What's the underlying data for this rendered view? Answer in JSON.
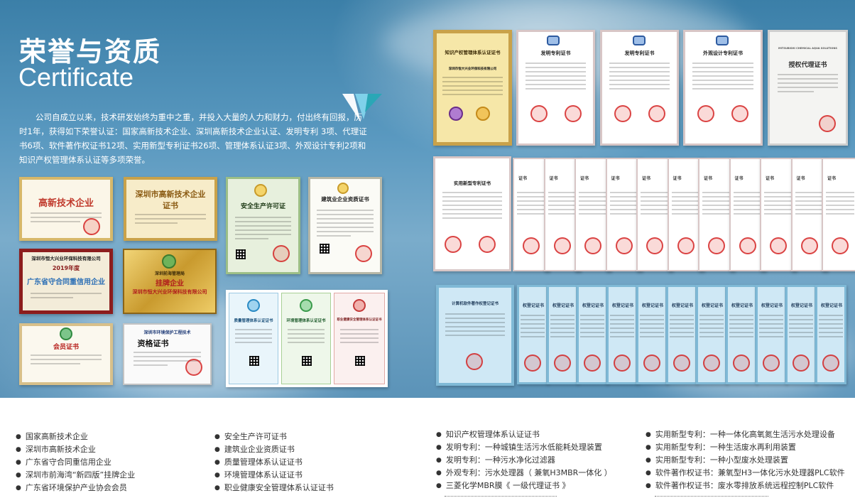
{
  "header": {
    "title_cn": "荣誉与资质",
    "title_en": "Certificate",
    "intro": "公司自成立以来，技术研发始终为重中之重，并投入大量的人力和财力，付出终有回报，历时1年，获得如下荣誉认证：国家高新技术企业、深圳高新技术企业认证、发明专利 3项、代理证书6项、软件著作权证书12项、实用新型专利证书26项、管理体系认证3项、外观设计专利2项和知识产权管理体系认证等多项荣誉。"
  },
  "certificates": {
    "left": {
      "gaoxin": "高新技术企业",
      "shenzhen_gaoxin": "深圳市高新技术企业",
      "shenzhen_gaoxin_sub": "证书",
      "anquan": "安全生产许可证",
      "jianzhu": "建筑业企业资质证书",
      "shouxin_top": "深圳市恒大兴业环保科技有限公司",
      "shouxin_year": "2019年度",
      "shouxin_main": "广东省守合同重信用企业",
      "guapai_org": "深圳前海管理局",
      "guapai_main": "挂牌企业",
      "guapai_company": "深圳市恒大兴业环保科技有限公司",
      "huiyuan": "会员证书",
      "zige_top": "深圳市环境保护工程技术",
      "zige_main": "资格证书",
      "iso_1": "质量管理体系认证证书",
      "iso_2": "环境管理体系认证证书",
      "iso_3": "职业健康安全管理体系认证证书"
    },
    "top_row": {
      "ipm": "知识产权管理体系认证证书",
      "ipm_company": "深圳市恒大兴业环保科技有限公司",
      "patent1": "发明专利证书",
      "patent2": "发明专利证书",
      "design": "外观设计专利证书",
      "mitsubishi_brand": "MITSUBISHI CHEMICAL AQUA SOLUTIONS",
      "mitsubishi_title": "授权代理证书"
    },
    "utility": {
      "first": "实用新型专利证书",
      "short": "证书"
    },
    "software": {
      "first": "计算机软件著作权登记证书",
      "short": "权登记证书"
    }
  },
  "lists": {
    "col1": [
      "国家高新技术企业",
      "深圳市高新技术企业",
      "广东省守合同重信用企业",
      "深圳市前海湾“新四版”挂牌企业",
      "广东省环境保护产业协会会员"
    ],
    "col2": [
      "安全生产许可证书",
      "建筑业企业资质证书",
      "质量管理体系认证证书",
      "环境管理体系认证证书",
      "职业健康安全管理体系认证证书"
    ],
    "col3": [
      "知识产权管理体系认证证书",
      "发明专利：一种城镇生活污水低能耗处理装置",
      "发明专利：一种污水净化过滤器",
      "外观专利：污水处理器（ 兼氧H3MBR一体化 ）",
      "三菱化学MBR膜《 一级代理证书 》"
    ],
    "col4": [
      "实用新型专利：一种一体化高氧氮生活污水处理设备",
      "实用新型专利：一种生活废水再利用装置",
      "实用新型专利：一种小型废水处理装置",
      "软件著作权证书：兼氧型H3一体化污水处理器PLC软件",
      "软件著作权证书：废水零排放系统远程控制PLC软件"
    ]
  },
  "colors": {
    "banner": "#5a99c0",
    "gold": "#c9a24a",
    "seal_red": "#d21e1e",
    "software_blue": "#bfe0f2",
    "text": "#333333"
  }
}
